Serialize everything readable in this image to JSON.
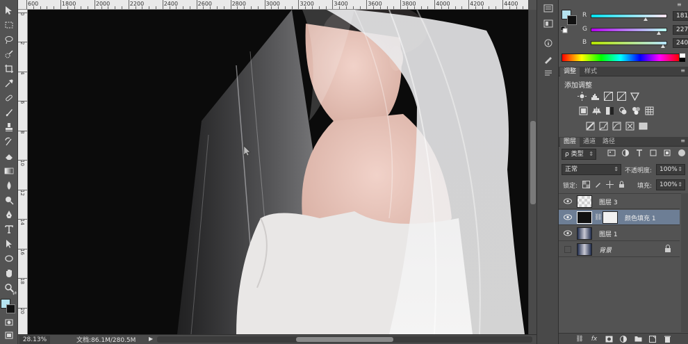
{
  "ruler": {
    "top_labels": [
      "600",
      "1800",
      "2000",
      "2200",
      "2400",
      "2600",
      "2800",
      "3000",
      "3200",
      "3400",
      "3600",
      "3800",
      "4000",
      "4200",
      "4400"
    ],
    "left_labels": [
      "0",
      "2",
      "4",
      "6",
      "8",
      "10",
      "12",
      "14",
      "16",
      "18",
      "20"
    ]
  },
  "status": {
    "zoom": "28.13%",
    "doc_info": "文档:86.1M/280.5M"
  },
  "color_panel": {
    "foreground": "#b5e3f0",
    "background": "#111111",
    "sliders": [
      {
        "label": "R",
        "value": "181",
        "fraction": 0.71
      },
      {
        "label": "G",
        "value": "227",
        "fraction": 0.89
      },
      {
        "label": "B",
        "value": "240",
        "fraction": 0.94
      }
    ]
  },
  "adjust_panel": {
    "tabs": [
      "调整",
      "样式"
    ],
    "title": "添加调整"
  },
  "layers_panel": {
    "tabs": [
      "图层",
      "通道",
      "路径"
    ],
    "filter_label": "ρ 类型",
    "blend_mode": "正常",
    "opacity_label": "不透明度:",
    "opacity_value": "100%",
    "lock_label": "锁定:",
    "fill_label": "填充:",
    "fill_value": "100%",
    "layers": [
      {
        "name": "图层 3",
        "visible": true,
        "selected": false,
        "italic": false
      },
      {
        "name": "颜色填充 1",
        "visible": true,
        "selected": true,
        "italic": false
      },
      {
        "name": "图层 1",
        "visible": true,
        "selected": false,
        "italic": false
      },
      {
        "name": "背景",
        "visible": false,
        "selected": false,
        "italic": true
      }
    ]
  },
  "colors": {
    "panel_bg": "#535353",
    "selected_layer": "#6d7e95",
    "canvas_bg": "#0b0b0b"
  }
}
